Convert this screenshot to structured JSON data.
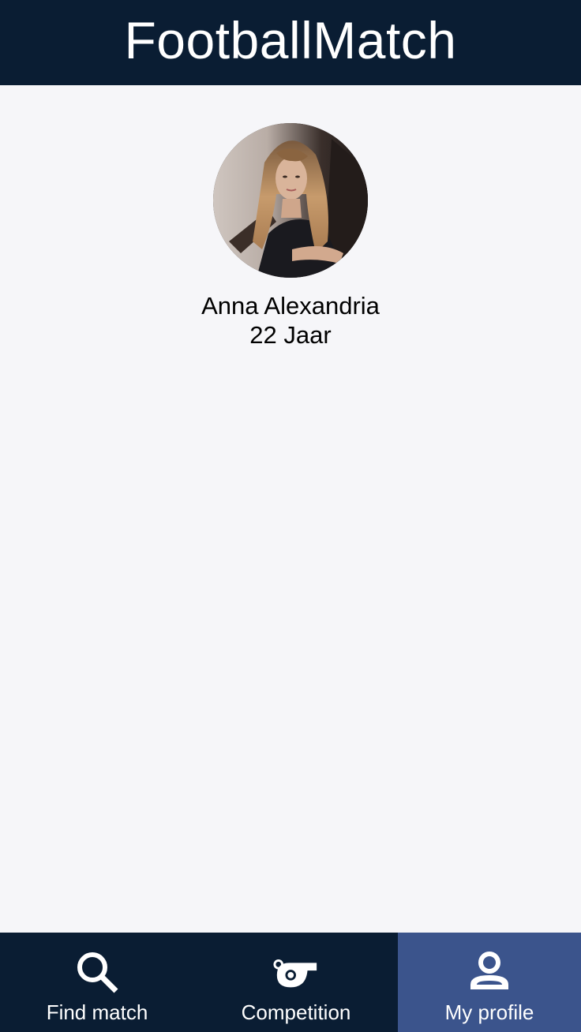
{
  "header": {
    "title": "FootballMatch"
  },
  "profile": {
    "name": "Anna Alexandria",
    "age": "22 Jaar"
  },
  "bottom_nav": {
    "items": [
      {
        "label": "Find match",
        "icon": "search-icon",
        "active": false
      },
      {
        "label": "Competition",
        "icon": "whistle-icon",
        "active": false
      },
      {
        "label": "My profile",
        "icon": "person-icon",
        "active": true
      }
    ]
  },
  "colors": {
    "header_bg": "#0a1d33",
    "nav_bg": "#0a1d33",
    "nav_active_bg": "#3b548c",
    "content_bg": "#f6f6f9"
  }
}
